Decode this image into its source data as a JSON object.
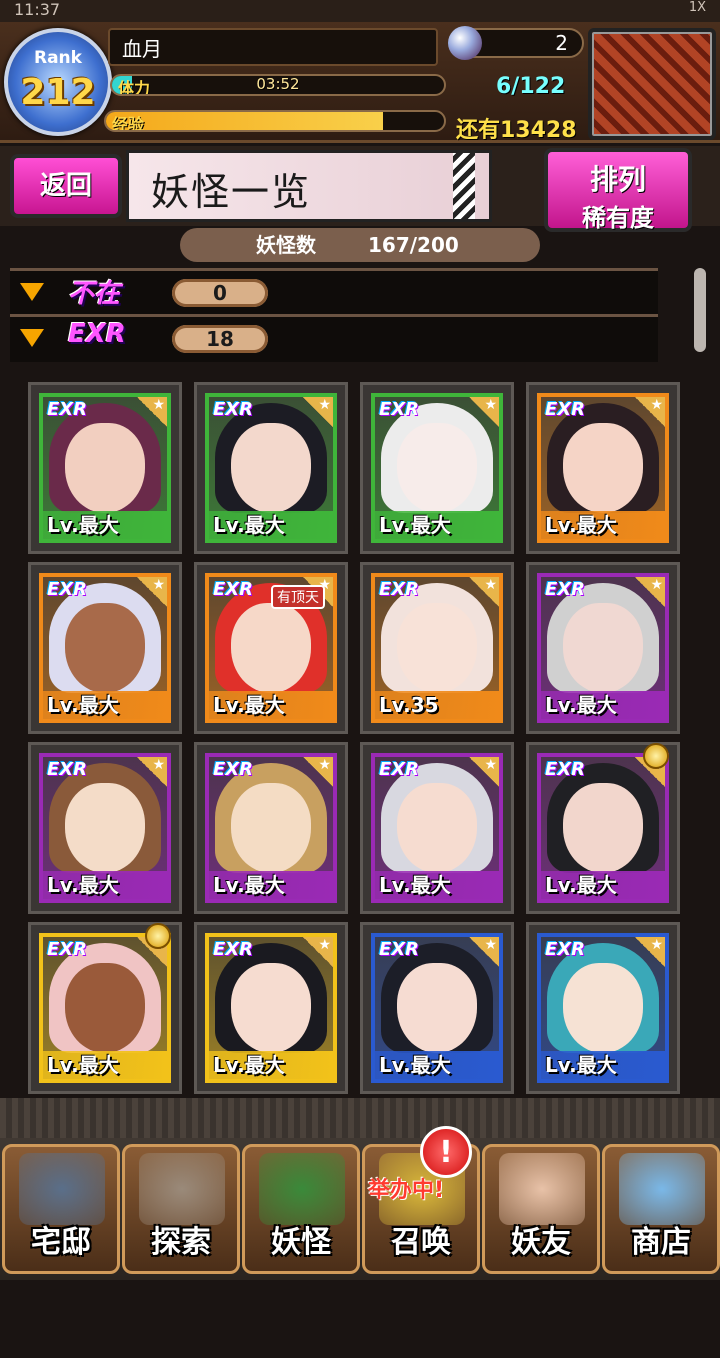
{
  "status": {
    "time": "11:37",
    "indicators": "1X"
  },
  "player": {
    "rank_label": "Rank",
    "rank": "212",
    "name": "血月",
    "stamina_label": "体力",
    "stamina_timer": "03:52",
    "stamina_fill": 0.06,
    "exp_label": "经验",
    "exp_fill": 0.82,
    "gems": "2",
    "capacity": "6/122",
    "exp_remaining": "还有13428"
  },
  "titlebar": {
    "back_label": "返回",
    "title": "妖怪一览",
    "sort_line1": "排列",
    "sort_line2": "稀有度"
  },
  "count": {
    "label": "妖怪数",
    "value": "167/200"
  },
  "filters": [
    {
      "badge": "不在",
      "count": "0"
    },
    {
      "badge": "EXR",
      "count": "18"
    }
  ],
  "cards": [
    {
      "rarity": "EXR",
      "level": "Lv.最大",
      "frame": "#3fb53a",
      "hair": "#6a2a4a",
      "skin": "#f2cfc0"
    },
    {
      "rarity": "EXR",
      "level": "Lv.最大",
      "frame": "#3fb53a",
      "hair": "#1c1c24",
      "skin": "#f3d8cc"
    },
    {
      "rarity": "EXR",
      "level": "Lv.最大",
      "frame": "#3fb53a",
      "hair": "#ececec",
      "skin": "#f7ecea"
    },
    {
      "rarity": "EXR",
      "level": "Lv.最大",
      "frame": "#f08a1a",
      "hair": "#2a1e22",
      "skin": "#f5d4c6"
    },
    {
      "rarity": "EXR",
      "level": "Lv.最大",
      "frame": "#f08a1a",
      "hair": "#dcdcf0",
      "skin": "#a86a4a"
    },
    {
      "rarity": "EXR",
      "level": "Lv.最大",
      "frame": "#f08a1a",
      "hair": "#e0302a",
      "skin": "#f6d8c8",
      "tag": "有顶天"
    },
    {
      "rarity": "EXR",
      "level": "Lv.35",
      "frame": "#f08a1a",
      "hair": "#f2e2dc",
      "skin": "#f8e2d8"
    },
    {
      "rarity": "EXR",
      "level": "Lv.最大",
      "frame": "#9a2ab5",
      "hair": "#d0d0d0",
      "skin": "#f0d8d2"
    },
    {
      "rarity": "EXR",
      "level": "Lv.最大",
      "frame": "#9a2ab5",
      "hair": "#8a5a3a",
      "skin": "#f4dcc8"
    },
    {
      "rarity": "EXR",
      "level": "Lv.最大",
      "frame": "#9a2ab5",
      "hair": "#c8a060",
      "skin": "#f4dcc4"
    },
    {
      "rarity": "EXR",
      "level": "Lv.最大",
      "frame": "#9a2ab5",
      "hair": "#d8d8e0",
      "skin": "#f6dcd0"
    },
    {
      "rarity": "EXR",
      "level": "Lv.最大",
      "frame": "#9a2ab5",
      "hair": "#202024",
      "skin": "#f2d6cc",
      "medal": true
    },
    {
      "rarity": "EXR",
      "level": "Lv.最大",
      "frame": "#f2c21a",
      "hair": "#f0c4c4",
      "skin": "#9a5a3a",
      "medal": true
    },
    {
      "rarity": "EXR",
      "level": "Lv.最大",
      "frame": "#f2c21a",
      "hair": "#1a1a20",
      "skin": "#f6dcd0"
    },
    {
      "rarity": "EXR",
      "level": "Lv.最大",
      "frame": "#2a5ad0",
      "hair": "#1c1e28",
      "skin": "#f6dcd2"
    },
    {
      "rarity": "EXR",
      "level": "Lv.最大",
      "frame": "#2a5ad0",
      "hair": "#3aa8b8",
      "skin": "#f6e2d4"
    }
  ],
  "nav": [
    {
      "label": "宅邸",
      "icon": "mansion-icon",
      "color": "#5a6f8a"
    },
    {
      "label": "探索",
      "icon": "magnifier-icon",
      "color": "#9a8a7a"
    },
    {
      "label": "妖怪",
      "icon": "scroll-icon",
      "color": "#3a8a3a"
    },
    {
      "label": "召唤",
      "icon": "summon-icon",
      "color": "#d9b83a"
    },
    {
      "label": "妖友",
      "icon": "friend-icon",
      "color": "#e8c2a8"
    },
    {
      "label": "商店",
      "icon": "orb-icon",
      "color": "#7ab8e8"
    }
  ],
  "promo": "举办中!",
  "alert": "!"
}
